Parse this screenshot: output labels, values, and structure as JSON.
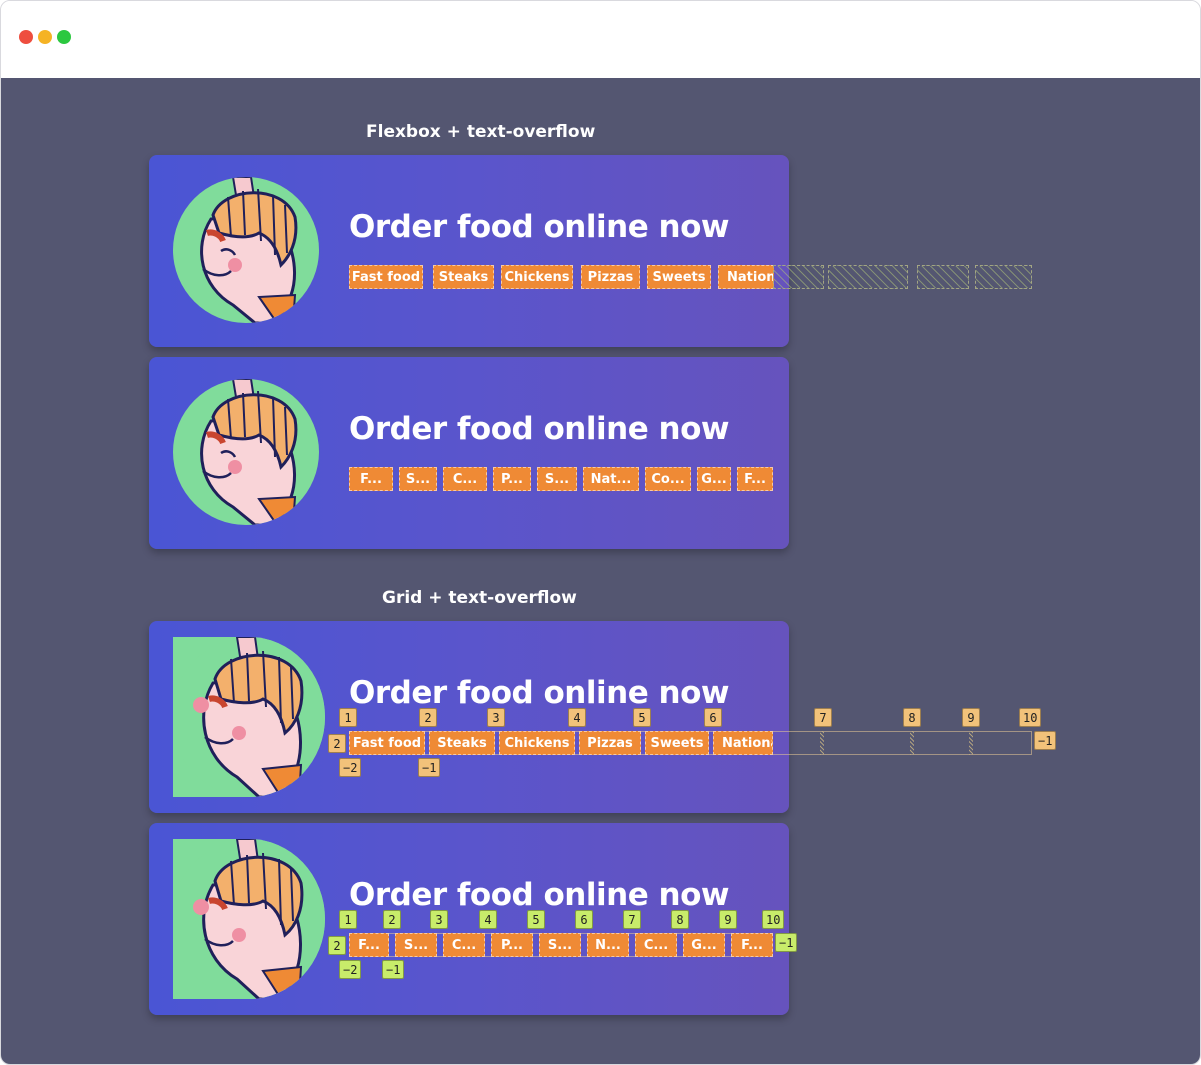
{
  "sections": [
    {
      "heading": "Flexbox + text-overflow"
    },
    {
      "heading": "Grid + text-overflow"
    }
  ],
  "card_title": "Order food online now",
  "tags_full": [
    "Fast food",
    "Steaks",
    "Chickens",
    "Pizzas",
    "Sweets",
    "Nationa"
  ],
  "tags_truncated": [
    "F...",
    "S...",
    "C...",
    "P...",
    "S...",
    "Nat...",
    "Co...",
    "G...",
    "F..."
  ],
  "grid_tags_full": [
    "Fast food",
    "Steaks",
    "Chickens",
    "Pizzas",
    "Sweets",
    "Nationa"
  ],
  "grid_tags_truncated": [
    "F...",
    "S...",
    "C...",
    "P...",
    "S...",
    "N...",
    "C...",
    "G...",
    "F..."
  ],
  "grid1_column_numbers": [
    "1",
    "2",
    "3",
    "4",
    "5",
    "6",
    "7",
    "8",
    "9",
    "10"
  ],
  "grid1_row_start": "2",
  "grid1_row_end": "−1",
  "grid1_neg_cols": [
    "−2",
    "−1"
  ],
  "grid2_column_numbers": [
    "1",
    "2",
    "3",
    "4",
    "5",
    "6",
    "7",
    "8",
    "9",
    "10"
  ],
  "grid2_row_start": "2",
  "grid2_row_end": "−1",
  "grid2_neg_cols": [
    "−2",
    "−1"
  ],
  "colors": {
    "card_start": "#4a55d4",
    "card_end": "#6653bd",
    "tag": "#ef8a35",
    "avatar_bg": "#80dc9b",
    "stage": "#545671"
  }
}
